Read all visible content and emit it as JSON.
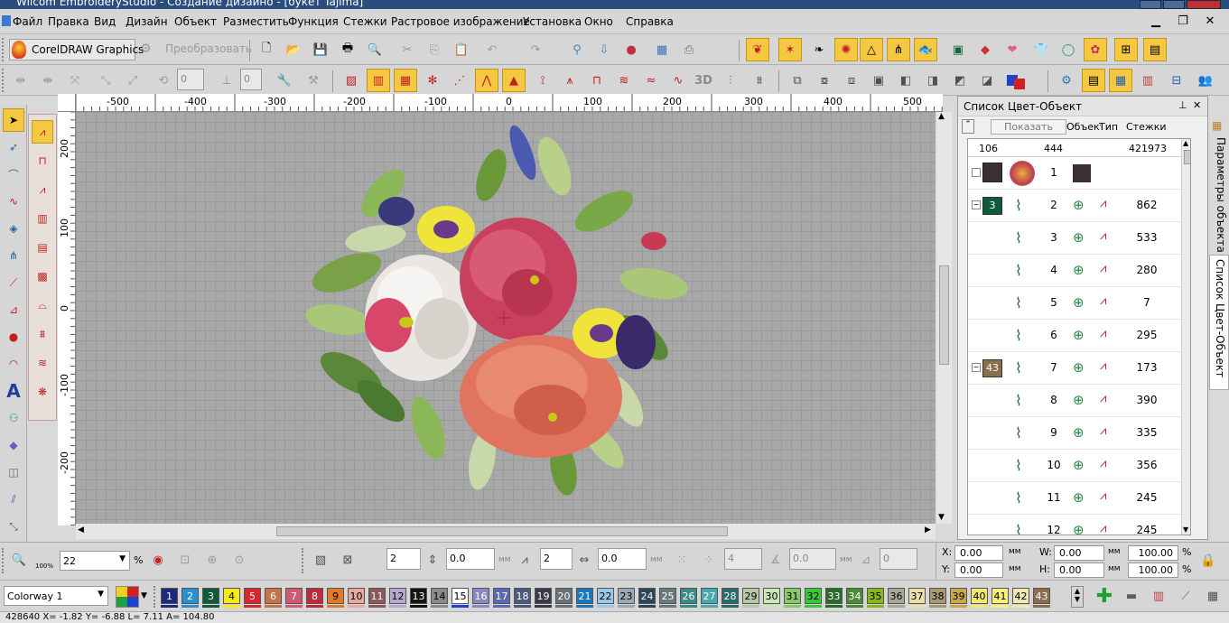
{
  "window": {
    "title": "Wilcom EmbroideryStudio - Создание дизайно - [букет       Tajima]"
  },
  "menu": [
    "Файл",
    "Правка",
    "Вид",
    "Дизайн",
    "Объект",
    "Разместить",
    "Функция",
    "Стежки",
    "Растровое изображение",
    "Установка",
    "Окно",
    "Справка"
  ],
  "toolbar": {
    "coreldraw_label": "CorelDRAW Graphics",
    "convert_label": "Преобразовать",
    "rotate_value": "0",
    "skew_value": "0",
    "label_3d": "3D"
  },
  "ruler": {
    "h": [
      "-500",
      "-400",
      "-300",
      "-200",
      "-100",
      "0",
      "100",
      "200",
      "300",
      "400",
      "500"
    ],
    "v": [
      "200",
      "100",
      "0",
      "-100",
      "-200"
    ]
  },
  "panel": {
    "title": "Список Цвет-Объект",
    "show_button": "Показать",
    "col_object": "Объект",
    "col_type": "Тип",
    "col_stitches": "Стежки",
    "sum_colors": "106",
    "sum_objects": "444",
    "sum_stitches": "421973",
    "rows": [
      {
        "num": "1",
        "count": "",
        "color_badge": "",
        "badge_color": ""
      },
      {
        "num": "2",
        "count": "862",
        "color_badge": "3",
        "badge_color": "#0f5a3a"
      },
      {
        "num": "3",
        "count": "533",
        "color_badge": "",
        "badge_color": ""
      },
      {
        "num": "4",
        "count": "280",
        "color_badge": "",
        "badge_color": ""
      },
      {
        "num": "5",
        "count": "7",
        "color_badge": "",
        "badge_color": ""
      },
      {
        "num": "6",
        "count": "295",
        "color_badge": "",
        "badge_color": ""
      },
      {
        "num": "7",
        "count": "173",
        "color_badge": "43",
        "badge_color": "#8a6e4e"
      },
      {
        "num": "8",
        "count": "390",
        "color_badge": "",
        "badge_color": ""
      },
      {
        "num": "9",
        "count": "335",
        "color_badge": "",
        "badge_color": ""
      },
      {
        "num": "10",
        "count": "356",
        "color_badge": "",
        "badge_color": ""
      },
      {
        "num": "11",
        "count": "245",
        "color_badge": "",
        "badge_color": ""
      },
      {
        "num": "12",
        "count": "245",
        "color_badge": "",
        "badge_color": ""
      }
    ]
  },
  "sidetabs": [
    "Параметры объекта",
    "Список Цвет-Объект"
  ],
  "zoom": {
    "value": "22",
    "unit": "%",
    "label_100": "100%"
  },
  "stitch_bar": {
    "v1": "2",
    "v2": "0.0",
    "v3": "2",
    "v4": "0.0",
    "v5": "4",
    "v6": "0.0",
    "v7": "0",
    "mm": "мм"
  },
  "coords": {
    "x_label": "X:",
    "y_label": "Y:",
    "w_label": "W:",
    "h_label": "H:",
    "x": "0.00",
    "y": "0.00",
    "w": "0.00",
    "h": "0.00",
    "unit": "мм",
    "sx": "100.00",
    "sy": "100.00",
    "pct": "%"
  },
  "colorway": {
    "label": "Colorway 1"
  },
  "palette": [
    {
      "n": "1",
      "c": "#1f2a7a",
      "t": "#fff",
      "u": "#1f2a7a"
    },
    {
      "n": "2",
      "c": "#2a8fd0",
      "t": "#fff",
      "u": "#2a8fd0"
    },
    {
      "n": "3",
      "c": "#0f5a3a",
      "t": "#fff",
      "u": "#0f5a3a"
    },
    {
      "n": "4",
      "c": "#f4e81a",
      "t": "#000",
      "u": "#f4e81a"
    },
    {
      "n": "5",
      "c": "#d8262e",
      "t": "#fff",
      "u": "#d8262e"
    },
    {
      "n": "6",
      "c": "#c47448",
      "t": "#fff",
      "u": "#c47448"
    },
    {
      "n": "7",
      "c": "#d05a74",
      "t": "#fff",
      "u": "#d05a74"
    },
    {
      "n": "8",
      "c": "#c02a3c",
      "t": "#fff",
      "u": "#c02a3c"
    },
    {
      "n": "9",
      "c": "#e07a2a",
      "t": "#000",
      "u": "#e07a2a"
    },
    {
      "n": "10",
      "c": "#e8a8a0",
      "t": "#000",
      "u": "#e8a8a0"
    },
    {
      "n": "11",
      "c": "#8a5a5a",
      "t": "#fff",
      "u": "#8a5a5a"
    },
    {
      "n": "12",
      "c": "#b8a8d0",
      "t": "#000",
      "u": "#b8a8d0"
    },
    {
      "n": "13",
      "c": "#141414",
      "t": "#fff",
      "u": "#141414"
    },
    {
      "n": "14",
      "c": "#8a8a8a",
      "t": "#000",
      "u": "#8a8a8a"
    },
    {
      "n": "15",
      "c": "#ffffff",
      "t": "#000",
      "u": "#2040d0"
    },
    {
      "n": "16",
      "c": "#8a88c0",
      "t": "#fff",
      "u": "#8a88c0"
    },
    {
      "n": "17",
      "c": "#5a6ab0",
      "t": "#fff",
      "u": "#5a6ab0"
    },
    {
      "n": "18",
      "c": "#4a5a78",
      "t": "#fff",
      "u": "#4a5a78"
    },
    {
      "n": "19",
      "c": "#3a3a4a",
      "t": "#fff",
      "u": "#3a3a4a"
    },
    {
      "n": "20",
      "c": "#6a7078",
      "t": "#fff",
      "u": "#6a7078"
    },
    {
      "n": "21",
      "c": "#1a78b8",
      "t": "#fff",
      "u": "#1a78b8"
    },
    {
      "n": "22",
      "c": "#9ac8e8",
      "t": "#000",
      "u": "#9ac8e8"
    },
    {
      "n": "23",
      "c": "#9aa8b8",
      "t": "#000",
      "u": "#9aa8b8"
    },
    {
      "n": "24",
      "c": "#2a4858",
      "t": "#fff",
      "u": "#2a4858"
    },
    {
      "n": "25",
      "c": "#6a7a7a",
      "t": "#fff",
      "u": "#6a7a7a"
    },
    {
      "n": "26",
      "c": "#3a8a8a",
      "t": "#fff",
      "u": "#3a8a8a"
    },
    {
      "n": "27",
      "c": "#48a8b0",
      "t": "#fff",
      "u": "#48a8b0"
    },
    {
      "n": "28",
      "c": "#2a6a6a",
      "t": "#fff",
      "u": "#2a6a6a"
    },
    {
      "n": "29",
      "c": "#b8c8a8",
      "t": "#000",
      "u": "#b8c8a8"
    },
    {
      "n": "30",
      "c": "#c8e8b8",
      "t": "#000",
      "u": "#c8e8b8"
    },
    {
      "n": "31",
      "c": "#88c868",
      "t": "#000",
      "u": "#88c868"
    },
    {
      "n": "32",
      "c": "#38c838",
      "t": "#000",
      "u": "#38c838"
    },
    {
      "n": "33",
      "c": "#2a6a2a",
      "t": "#fff",
      "u": "#2a6a2a"
    },
    {
      "n": "34",
      "c": "#4a8a3a",
      "t": "#fff",
      "u": "#4a8a3a"
    },
    {
      "n": "35",
      "c": "#88b818",
      "t": "#000",
      "u": "#88b818"
    },
    {
      "n": "36",
      "c": "#a8a898",
      "t": "#000",
      "u": "#a8a898"
    },
    {
      "n": "37",
      "c": "#e8e0a8",
      "t": "#000",
      "u": "#e8e0a8"
    },
    {
      "n": "38",
      "c": "#a89870",
      "t": "#000",
      "u": "#a89870"
    },
    {
      "n": "39",
      "c": "#c8a848",
      "t": "#000",
      "u": "#c8a848"
    },
    {
      "n": "40",
      "c": "#f0e870",
      "t": "#000",
      "u": "#f0e870"
    },
    {
      "n": "41",
      "c": "#f8f078",
      "t": "#000",
      "u": "#f8f078"
    },
    {
      "n": "42",
      "c": "#f0e8b0",
      "t": "#000",
      "u": "#f0e8b0"
    },
    {
      "n": "43",
      "c": "#8a6e4e",
      "t": "#fff",
      "u": "#8a6e4e"
    }
  ],
  "status": {
    "text": "428640      X=  -1.82 Y=  -6.88 L=  7.11 A= 104.80"
  }
}
